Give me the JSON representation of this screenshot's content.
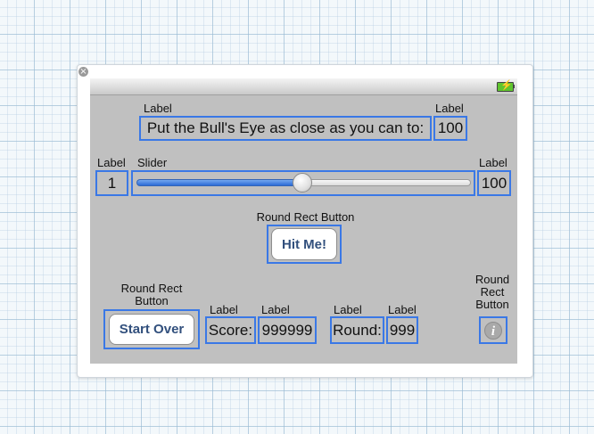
{
  "window": {
    "close_glyph": "×"
  },
  "status_bar": {
    "battery_icon": "battery-charging-icon",
    "bolt_glyph": "⚡"
  },
  "target_prompt": {
    "caption": "Label",
    "text": "Put the Bull's Eye as close as you can to:"
  },
  "target_value": {
    "caption": "Label",
    "text": "100"
  },
  "min_label": {
    "caption": "Label",
    "text": "1"
  },
  "slider": {
    "caption": "Slider",
    "min": 1,
    "max": 100,
    "value": 50
  },
  "max_label": {
    "caption": "Label",
    "text": "100"
  },
  "hit_button": {
    "caption": "Round Rect Button",
    "label": "Hit Me!"
  },
  "start_over_button": {
    "caption": "Round Rect Button",
    "label": "Start Over"
  },
  "score_label": {
    "caption": "Label",
    "text": "Score:"
  },
  "score_value": {
    "caption": "Label",
    "text": "999999"
  },
  "round_label": {
    "caption": "Label",
    "text": "Round:"
  },
  "round_value": {
    "caption": "Label",
    "text": "999"
  },
  "info_button": {
    "caption": "Round Rect Button",
    "icon": "info-icon",
    "glyph": "i"
  }
}
